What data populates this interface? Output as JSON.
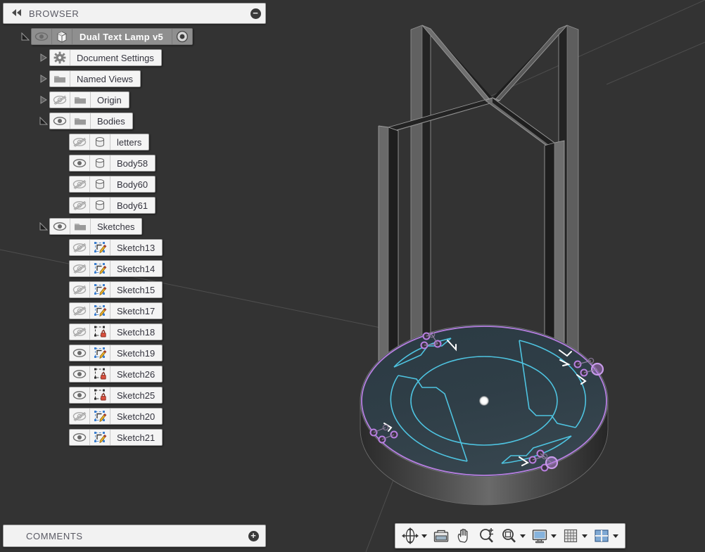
{
  "browser": {
    "title": "BROWSER",
    "collapse_icon": "double-left-arrow-icon",
    "minimize_icon": "minus-circle-icon",
    "root": {
      "label": "Dual Text Lamp v5",
      "icon": "component-icon",
      "visibility_icon": "eye-visible-icon",
      "state_icon": "activate-radio-icon",
      "expanded": true,
      "selected": true
    },
    "items": [
      {
        "label": "Document Settings",
        "icon": "gear-icon",
        "indent": 1,
        "expanded": false,
        "has_twisty": true,
        "visibility": "none"
      },
      {
        "label": "Named Views",
        "icon": "folder-icon",
        "indent": 1,
        "expanded": false,
        "has_twisty": true,
        "visibility": "none"
      },
      {
        "label": "Origin",
        "icon": "folder-icon",
        "indent": 1,
        "expanded": false,
        "has_twisty": true,
        "visibility": "hidden"
      },
      {
        "label": "Bodies",
        "icon": "folder-icon",
        "indent": 1,
        "expanded": true,
        "has_twisty": true,
        "visibility": "visible"
      },
      {
        "label": "letters",
        "icon": "body-icon",
        "indent": 2,
        "has_twisty": false,
        "visibility": "hidden"
      },
      {
        "label": "Body58",
        "icon": "body-icon",
        "indent": 2,
        "has_twisty": false,
        "visibility": "visible"
      },
      {
        "label": "Body60",
        "icon": "body-icon",
        "indent": 2,
        "has_twisty": false,
        "visibility": "hidden"
      },
      {
        "label": "Body61",
        "icon": "body-icon",
        "indent": 2,
        "has_twisty": false,
        "visibility": "hidden"
      },
      {
        "label": "Sketches",
        "icon": "folder-icon",
        "indent": 1,
        "expanded": true,
        "has_twisty": true,
        "visibility": "visible"
      },
      {
        "label": "Sketch13",
        "icon": "sketch-icon",
        "indent": 2,
        "has_twisty": false,
        "visibility": "hidden"
      },
      {
        "label": "Sketch14",
        "icon": "sketch-icon",
        "indent": 2,
        "has_twisty": false,
        "visibility": "hidden"
      },
      {
        "label": "Sketch15",
        "icon": "sketch-icon",
        "indent": 2,
        "has_twisty": false,
        "visibility": "hidden"
      },
      {
        "label": "Sketch17",
        "icon": "sketch-icon",
        "indent": 2,
        "has_twisty": false,
        "visibility": "hidden"
      },
      {
        "label": "Sketch18",
        "icon": "sketch-locked-icon",
        "indent": 2,
        "has_twisty": false,
        "visibility": "hidden"
      },
      {
        "label": "Sketch19",
        "icon": "sketch-icon",
        "indent": 2,
        "has_twisty": false,
        "visibility": "visible"
      },
      {
        "label": "Sketch26",
        "icon": "sketch-locked-icon",
        "indent": 2,
        "has_twisty": false,
        "visibility": "visible"
      },
      {
        "label": "Sketch25",
        "icon": "sketch-locked-icon",
        "indent": 2,
        "has_twisty": false,
        "visibility": "visible"
      },
      {
        "label": "Sketch20",
        "icon": "sketch-icon",
        "indent": 2,
        "has_twisty": false,
        "visibility": "hidden"
      },
      {
        "label": "Sketch21",
        "icon": "sketch-icon",
        "indent": 2,
        "has_twisty": false,
        "visibility": "visible"
      }
    ]
  },
  "comments": {
    "title": "COMMENTS",
    "add_icon": "plus-circle-icon"
  },
  "nav_toolbar": {
    "items": [
      {
        "name": "orbit-tool",
        "icon": "orbit-icon",
        "caret": true
      },
      {
        "name": "look-at-tool",
        "icon": "look-at-camera-icon",
        "caret": false
      },
      {
        "name": "pan-tool",
        "icon": "pan-hand-icon",
        "caret": false
      },
      {
        "name": "zoom-tool",
        "icon": "zoom-magnifier-icon",
        "caret": false
      },
      {
        "name": "zoom-fit-tool",
        "icon": "zoom-fit-icon",
        "caret": true
      },
      {
        "name": "display-settings",
        "icon": "monitor-icon",
        "caret": true
      },
      {
        "name": "grid-snaps",
        "icon": "grid-icon",
        "caret": true
      },
      {
        "name": "viewports-layout",
        "icon": "viewport-layout-icon",
        "caret": true
      }
    ]
  },
  "viewport": {
    "name": "3d-canvas",
    "background": "#333333",
    "model_title": "Dual Text Lamp v5",
    "origin_point_color": "#ffffff",
    "sketch_curve_color": "#4ec3e0",
    "sketch_construction_color": "#b87fe0",
    "projected_edge_color": "#ffffff",
    "body_light_face": "#6d6d6d",
    "body_mid_face": "#4a4a4a",
    "body_dark_face": "#1c1c1c",
    "base_top_color": "#2e3c44"
  }
}
